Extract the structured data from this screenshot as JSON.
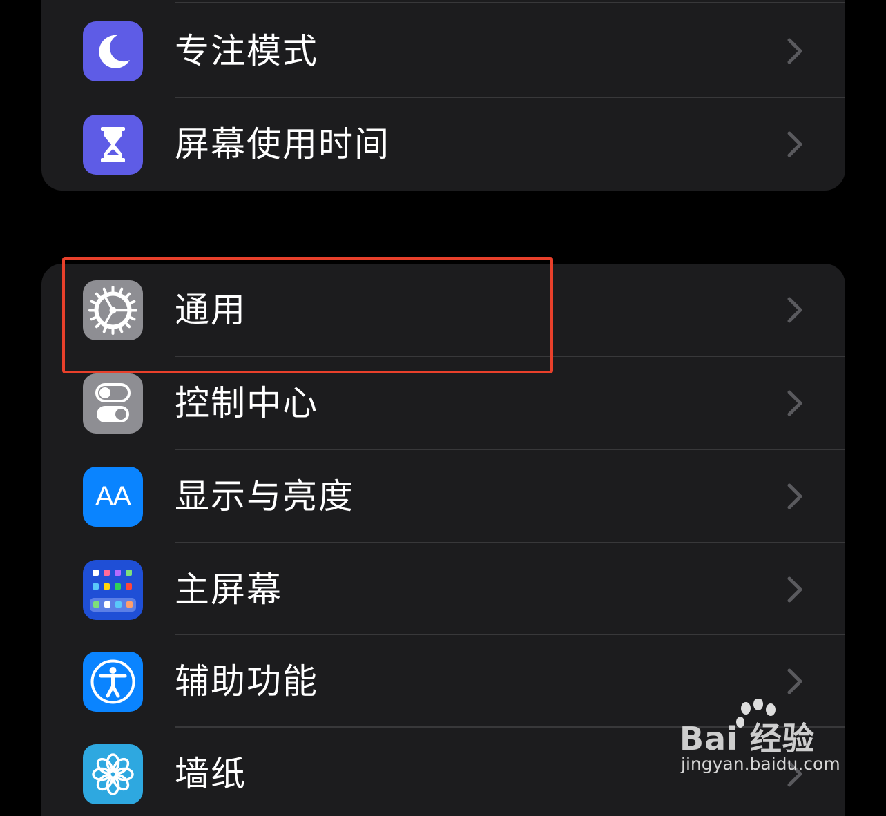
{
  "settings_group_1": {
    "items": [
      {
        "label": "专注模式",
        "icon": "moon-icon",
        "icon_color": "#5e5ce6"
      },
      {
        "label": "屏幕使用时间",
        "icon": "hourglass-icon",
        "icon_color": "#5e5ce6"
      }
    ]
  },
  "settings_group_2": {
    "items": [
      {
        "label": "通用",
        "icon": "gear-icon",
        "icon_color": "#8e8e93"
      },
      {
        "label": "控制中心",
        "icon": "toggles-icon",
        "icon_color": "#8e8e93"
      },
      {
        "label": "显示与亮度",
        "icon": "text-size-icon",
        "icon_text": "AA",
        "icon_color": "#0a84ff"
      },
      {
        "label": "主屏幕",
        "icon": "home-screen-grid-icon",
        "icon_color": "#1f4fd6"
      },
      {
        "label": "辅助功能",
        "icon": "accessibility-icon",
        "icon_color": "#0a84ff"
      },
      {
        "label": "墙纸",
        "icon": "flower-icon",
        "icon_color": "#2ea8e0"
      }
    ]
  },
  "highlight": {
    "target": "通用",
    "color": "#e8402b"
  },
  "watermark": {
    "brand": "Bai  经验",
    "url": "jingyan.baidu.com"
  }
}
